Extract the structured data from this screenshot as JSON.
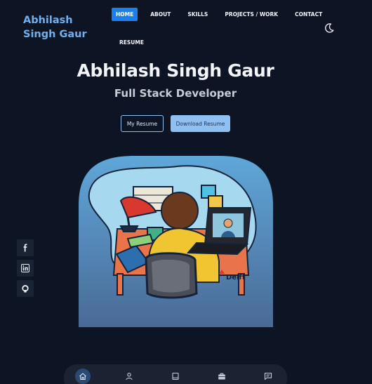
{
  "brand": {
    "name": "Abhilash Singh Gaur"
  },
  "nav": {
    "items": [
      {
        "label": "HOME",
        "active": true
      },
      {
        "label": "ABOUT"
      },
      {
        "label": "SKILLS"
      },
      {
        "label": "PROJECTS / WORK"
      },
      {
        "label": "CONTACT"
      },
      {
        "label": "RESUME"
      }
    ],
    "theme_toggle_icon": "moon-icon"
  },
  "hero": {
    "name": "Abhilash Singh Gaur",
    "role": "Full Stack Developer",
    "buttons": {
      "primary": "My Resume",
      "secondary": "Download Resume"
    },
    "illustration_watermark": "Delft"
  },
  "social": [
    "facebook-icon",
    "linkedin-icon",
    "github-icon"
  ],
  "bottom_nav": [
    "home-icon",
    "user-icon",
    "book-icon",
    "briefcase-icon",
    "message-icon"
  ],
  "colors": {
    "background": "#0d1424",
    "accent": "#1f7fe6",
    "brand": "#6fb1ee",
    "button_fill": "#8fc0f2"
  }
}
